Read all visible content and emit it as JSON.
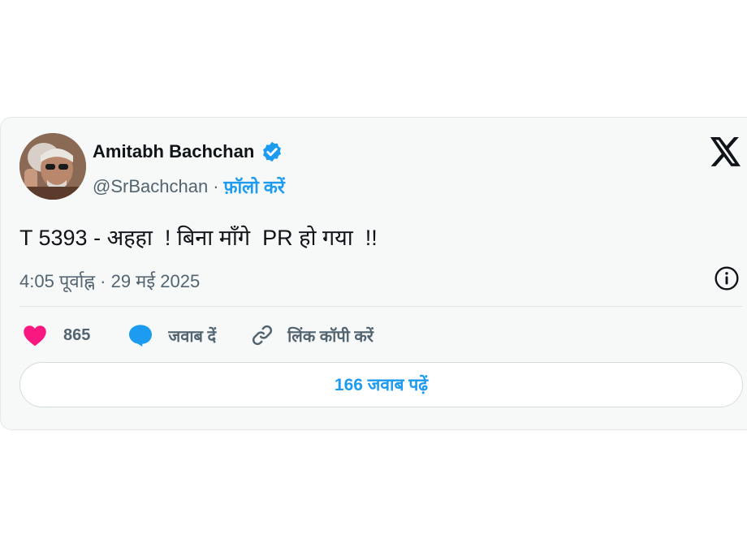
{
  "author": {
    "name": "Amitabh Bachchan",
    "handle": "@SrBachchan",
    "separator": "·",
    "follow_label": "फ़ॉलो करें",
    "avatar_icon": "profile-photo",
    "verified_icon": "verified-badge-icon"
  },
  "tweet": {
    "text": "T 5393 - अहहा  ! बिना माँगे  PR हो गया  !!",
    "timestamp": "4:05 पूर्वाह्न · 29 मई 2025"
  },
  "actions": {
    "like_count": "865",
    "reply_label": "जवाब दें",
    "copy_link_label": "लिंक कॉपी करें"
  },
  "read_replies_label": "166 जवाब पढ़ें",
  "colors": {
    "accent": "#1d9bf0",
    "like": "#f91880",
    "secondary_text": "#536471",
    "card_background": "#f7f9f9"
  }
}
